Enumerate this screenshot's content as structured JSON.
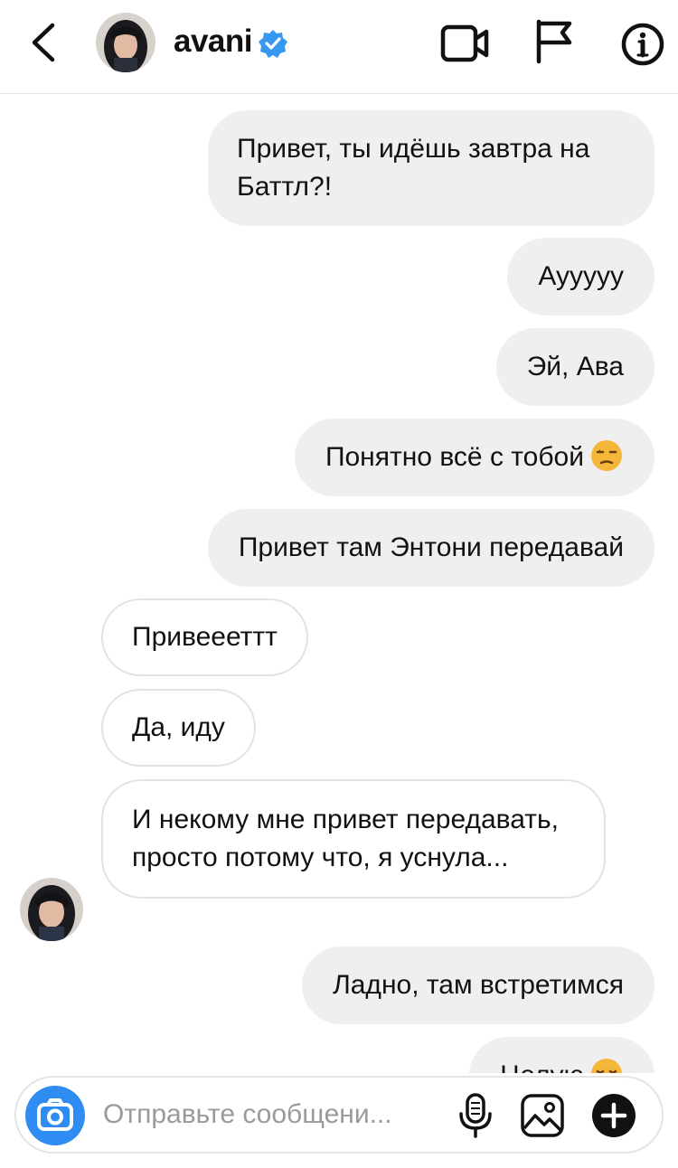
{
  "header": {
    "username": "avani",
    "icons": {
      "back": "chevron-left-icon",
      "verified": "verified-badge-icon",
      "video": "video-camera-icon",
      "flag": "flag-icon",
      "info": "info-icon"
    }
  },
  "messages": [
    {
      "side": "outgoing",
      "text": "Привет, ты идёшь завтра на Баттл?!"
    },
    {
      "side": "outgoing",
      "text": "Аууууу"
    },
    {
      "side": "outgoing",
      "text": "Эй, Ава"
    },
    {
      "side": "outgoing",
      "text": "Понятно всё с тобой",
      "emoji": "unamused-face"
    },
    {
      "side": "outgoing",
      "text": "Привет там Энтони передавай"
    },
    {
      "side": "incoming",
      "text": "Привеееттт"
    },
    {
      "side": "incoming",
      "text": "Да, иду"
    },
    {
      "side": "incoming",
      "text": "И некому мне привет передавать, просто потому что, я уснула..."
    },
    {
      "side": "outgoing",
      "text": "Ладно, там встретимся"
    },
    {
      "side": "outgoing",
      "text": "Целую",
      "emoji": "relieved-face"
    }
  ],
  "composer": {
    "placeholder": "Отправьте сообщени...",
    "icons": {
      "camera": "camera-icon",
      "mic": "microphone-icon",
      "gallery": "image-icon",
      "add": "plus-icon"
    }
  },
  "colors": {
    "accent": "#2f8cf3",
    "outgoing_bubble": "#efefef",
    "incoming_border": "#e3e3e3",
    "emoji": "#f5b73a"
  }
}
